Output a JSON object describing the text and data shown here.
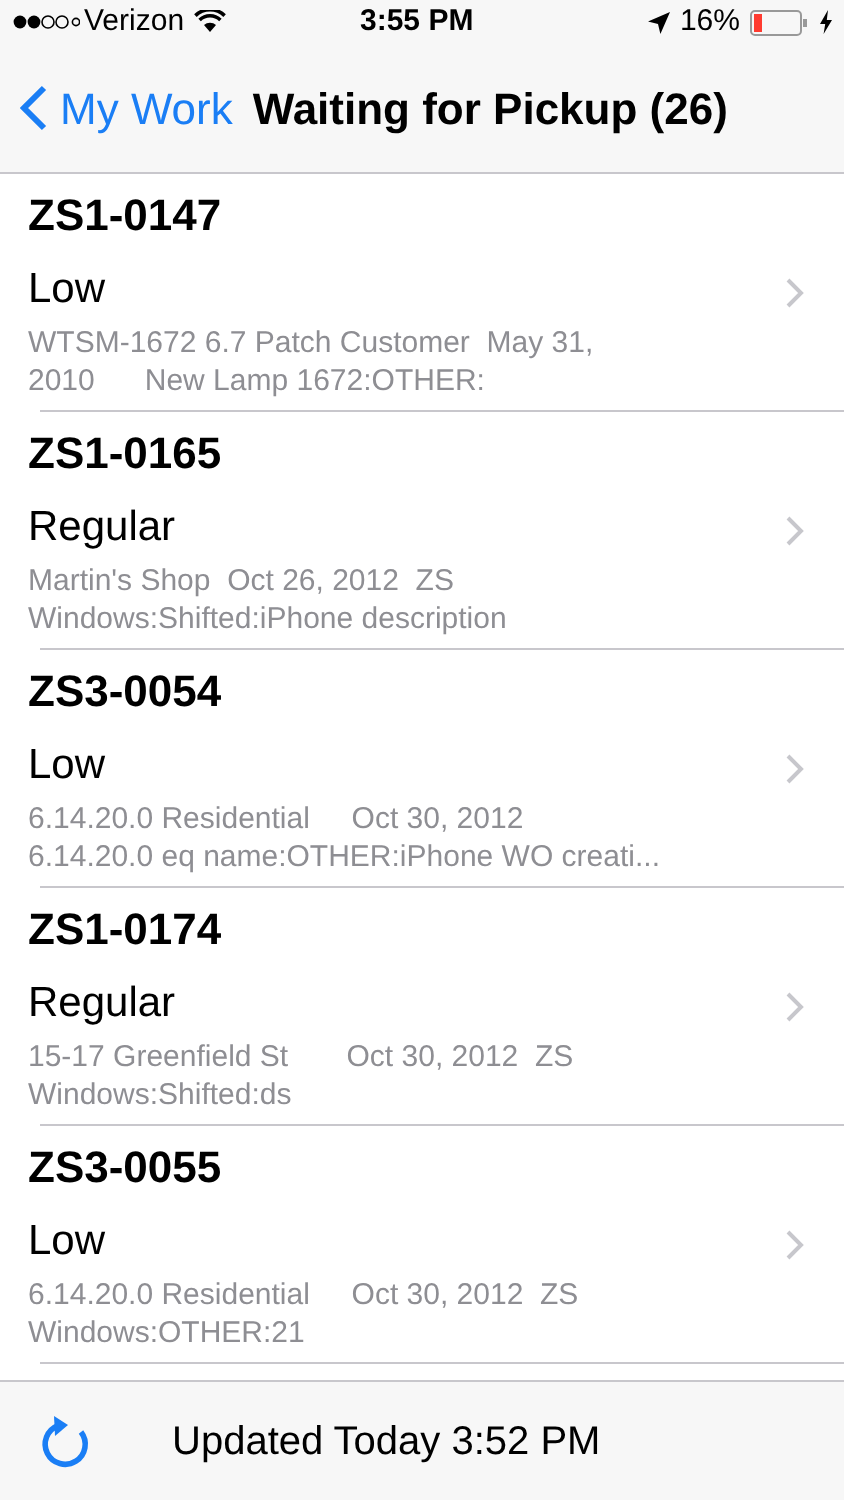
{
  "status_bar": {
    "carrier": "Verizon",
    "time": "3:55 PM",
    "battery": "16%"
  },
  "nav": {
    "back": "My Work",
    "title": "Waiting for Pickup (26)"
  },
  "rows": [
    {
      "id": "ZS1-0147",
      "priority": "Low",
      "details": [
        "WTSM-1672 6.7 Patch Customer  May 31,",
        "2010      New Lamp 1672:OTHER:"
      ]
    },
    {
      "id": "ZS1-0165",
      "priority": "Regular",
      "details": [
        "Martin's Shop  Oct 26, 2012  ZS",
        "Windows:Shifted:iPhone description"
      ]
    },
    {
      "id": "ZS3-0054",
      "priority": "Low",
      "details": [
        "6.14.20.0 Residential     Oct 30, 2012",
        "6.14.20.0 eq name:OTHER:iPhone WO creati..."
      ]
    },
    {
      "id": "ZS1-0174",
      "priority": "Regular",
      "details": [
        "15-17 Greenfield St       Oct 30, 2012  ZS",
        "Windows:Shifted:ds"
      ]
    },
    {
      "id": "ZS3-0055",
      "priority": "Low",
      "details": [
        "6.14.20.0 Residential     Oct 30, 2012  ZS",
        "Windows:OTHER:21"
      ]
    }
  ],
  "toolbar": {
    "updated": "Updated Today 3:52 PM"
  }
}
